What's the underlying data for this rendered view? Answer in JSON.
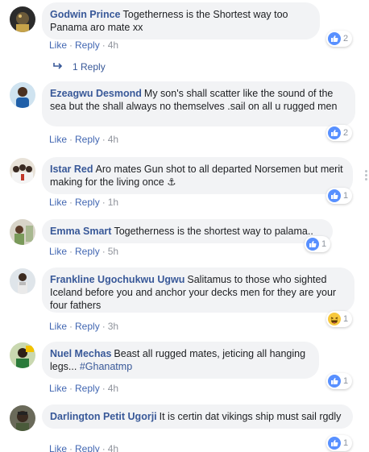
{
  "comments": [
    {
      "author": "Godwin Prince",
      "text": "Togetherness is the Shortest way too Panama aro mate xx",
      "actions": {
        "like": "Like",
        "reply": "Reply",
        "time": "4h"
      },
      "reaction": {
        "type": "like",
        "count": "2"
      },
      "replies_link": "1 Reply"
    },
    {
      "author": "Ezeagwu Desmond",
      "text": "My son's shall scatter like the sound of the sea but the shall always no themselves .sail on all u rugged men",
      "actions": {
        "like": "Like",
        "reply": "Reply",
        "time": "4h"
      },
      "reaction": {
        "type": "like",
        "count": "2"
      }
    },
    {
      "author": "Istar Red",
      "text": "Aro mates Gun shot to all departed Norsemen but merit making for the living once ⚓",
      "actions": {
        "like": "Like",
        "reply": "Reply",
        "time": "1h"
      },
      "reaction": {
        "type": "like",
        "count": "1"
      }
    },
    {
      "author": "Emma Smart",
      "text": "Togetherness is the shortest way to palama..",
      "actions": {
        "like": "Like",
        "reply": "Reply",
        "time": "5h"
      },
      "reaction": {
        "type": "like",
        "count": "1"
      }
    },
    {
      "author": "Frankline Ugochukwu Ugwu",
      "text": "Salitamus to those who sighted Iceland before you and anchor your decks men for they are your four fathers",
      "actions": {
        "like": "Like",
        "reply": "Reply",
        "time": "3h"
      },
      "reaction": {
        "type": "haha",
        "count": "1"
      }
    },
    {
      "author": "Nuel Mechas",
      "text": "Beast all rugged mates, jeticing all hanging legs... ",
      "hashtag": "#Ghanatmp",
      "actions": {
        "like": "Like",
        "reply": "Reply",
        "time": "4h"
      },
      "reaction": {
        "type": "like",
        "count": "1"
      }
    },
    {
      "author": "Darlington Petit Ugorji",
      "text": "It is certin dat vikings ship must sail rgdly",
      "actions": {
        "like": "Like",
        "reply": "Reply",
        "time": "4h"
      },
      "reaction": {
        "type": "like",
        "count": "1"
      }
    }
  ],
  "colors": {
    "link": "#385898",
    "action": "#4267b2",
    "meta": "#90949c",
    "bubble": "#f2f3f5",
    "like": "#5890ff",
    "haha": "#f7c83d"
  }
}
